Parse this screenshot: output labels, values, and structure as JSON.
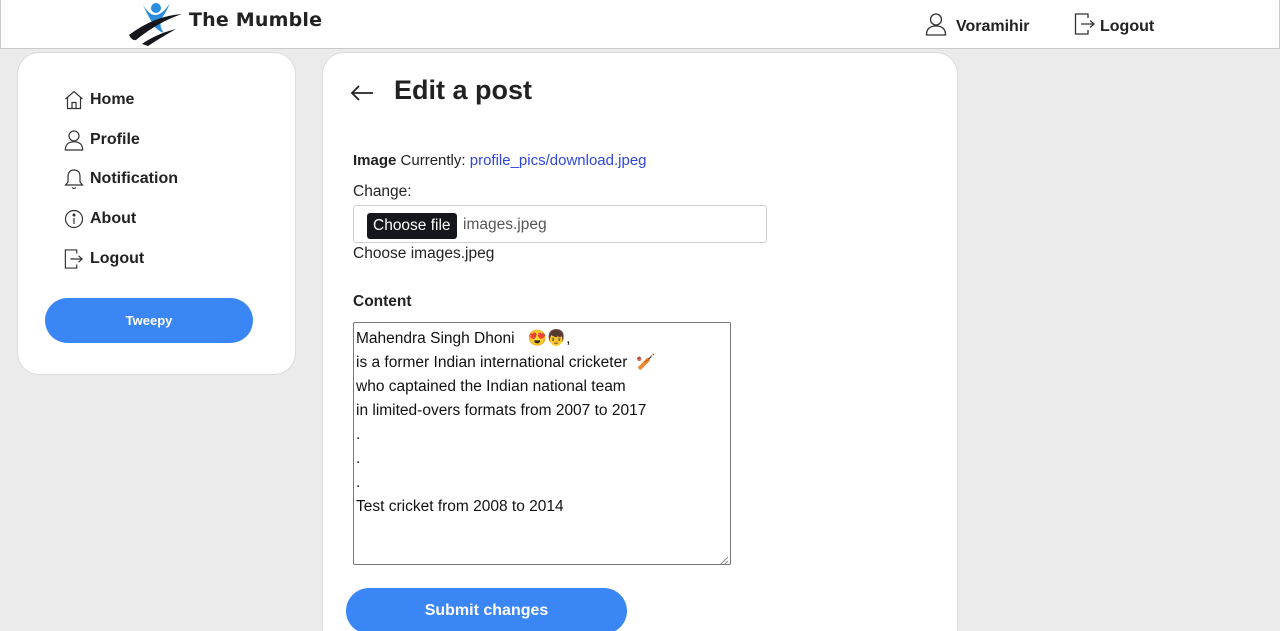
{
  "header": {
    "brand_name": "The Mumble",
    "username": "Voramihir",
    "logout_label": "Logout"
  },
  "sidebar": {
    "items": [
      {
        "label": "Home",
        "icon": "home-icon"
      },
      {
        "label": "Profile",
        "icon": "user-icon"
      },
      {
        "label": "Notification",
        "icon": "bell-icon"
      },
      {
        "label": "About",
        "icon": "info-icon"
      },
      {
        "label": "Logout",
        "icon": "logout-icon"
      }
    ],
    "tweepy_label": "Tweepy"
  },
  "main": {
    "title": "Edit a post",
    "image_label": "Image",
    "currently_label": "Currently:",
    "current_file": "profile_pics/download.jpeg",
    "change_label": "Change:",
    "choose_file_label": "Choose file",
    "selected_file": "images.jpeg",
    "choose_caption": "Choose images.jpeg",
    "content_label": "Content",
    "content_lines": [
      "Mahendra Singh Dhoni   😍👦,",
      "is a former Indian international cricketer  🏏",
      "who captained the Indian national team",
      "in limited-overs formats from 2007 to 2017",
      ".",
      ".",
      ".",
      "Test cricket from 2008 to 2014"
    ],
    "submit_label": "Submit changes"
  },
  "colors": {
    "accent": "#3b86f5",
    "link": "#2f46e0",
    "background": "#ebebeb"
  }
}
